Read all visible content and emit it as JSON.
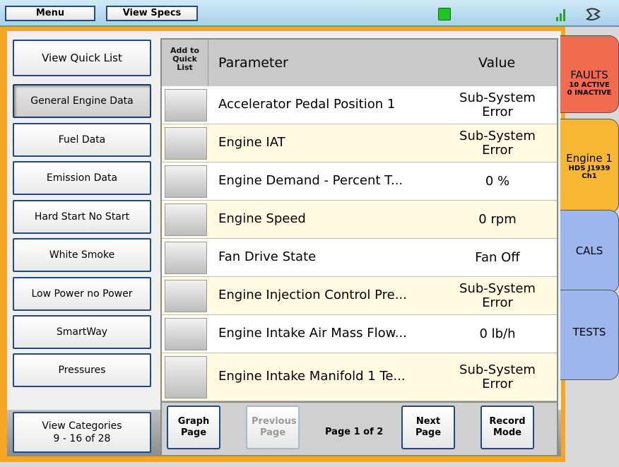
{
  "topbar": {
    "menu_label": "Menu",
    "view_specs_label": "View Specs",
    "status_color": "#21c521"
  },
  "sidebar": {
    "quick_list_label": "View Quick List",
    "categories": [
      {
        "label": "General Engine Data",
        "active": true
      },
      {
        "label": "Fuel Data",
        "active": false
      },
      {
        "label": "Emission Data",
        "active": false
      },
      {
        "label": "Hard Start No Start",
        "active": false
      },
      {
        "label": "White Smoke",
        "active": false
      },
      {
        "label": "Low Power no Power",
        "active": false
      },
      {
        "label": "SmartWay",
        "active": false
      },
      {
        "label": "Pressures",
        "active": false
      }
    ],
    "view_categories_line1": "View Categories",
    "view_categories_line2": "9 - 16 of 28"
  },
  "table": {
    "header_add": "Add to Quick List",
    "header_parameter": "Parameter",
    "header_value": "Value",
    "rows": [
      {
        "parameter": "Accelerator Pedal Position 1",
        "value": "Sub-System Error"
      },
      {
        "parameter": "Engine IAT",
        "value": "Sub-System Error"
      },
      {
        "parameter": "Engine Demand - Percent T...",
        "value": "0 %"
      },
      {
        "parameter": "Engine Speed",
        "value": "0 rpm"
      },
      {
        "parameter": "Fan Drive State",
        "value": "Fan Off"
      },
      {
        "parameter": "Engine Injection Control Pre...",
        "value": "Sub-System Error"
      },
      {
        "parameter": "Engine Intake Air Mass Flow...",
        "value": "0 lb/h"
      },
      {
        "parameter": "Engine Intake Manifold 1 Te...",
        "value": "Sub-System Error"
      }
    ]
  },
  "nav": {
    "graph_page": "Graph Page",
    "previous_page": "Previous Page",
    "page_info": "Page 1 of 2",
    "next_page": "Next Page",
    "record_mode": "Record Mode"
  },
  "tabs": {
    "faults_title": "FAULTS",
    "faults_active": "10 ACTIVE",
    "faults_inactive": "0 INACTIVE",
    "engine_title": "Engine 1",
    "engine_sub1": "HDS J1939",
    "engine_sub2": "Ch1",
    "cals_title": "CALS",
    "tests_title": "TESTS",
    "faults_color": "#f26b4f",
    "engine_color": "#f7b733",
    "cals_color": "#9db6ee",
    "tests_color": "#9db6ee"
  }
}
